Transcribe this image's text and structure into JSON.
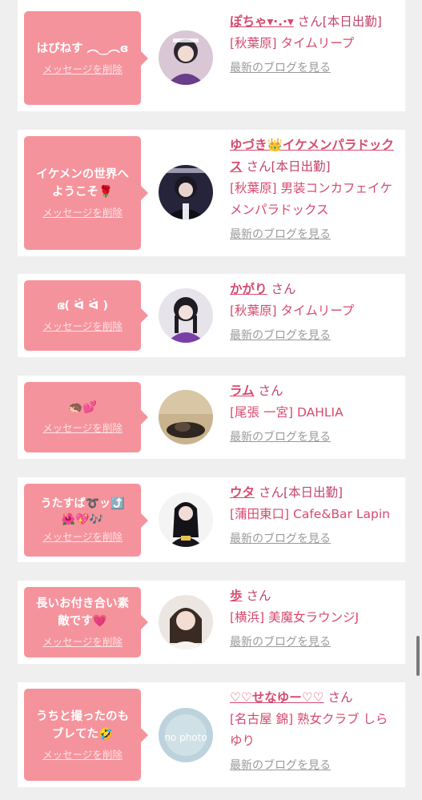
{
  "list": {
    "delete_label": "メッセージを削除",
    "blog_label": "最新のブログを見る",
    "san": "さん",
    "items": [
      {
        "message": "はぴねす ︵‿︵ɞ",
        "name": "ぽちゃ▾·.·▾",
        "after_name": "さん[本日出勤]",
        "shop": "[秋葉原] タイムリープ"
      },
      {
        "message": "イケメンの世界へ\nようこそ🌹",
        "name": "ゆづき👑イケメンパラドックス",
        "after_name": "さん[本日出勤]",
        "shop": "[秋葉原] 男装コンカフェイケメンパラドックス"
      },
      {
        "message": "ഭ( ᐛ ᐛ )",
        "name": "かがり",
        "after_name": "さん",
        "shop": "[秋葉原] タイムリープ"
      },
      {
        "message": "🦔💕",
        "name": "ラム",
        "after_name": "さん",
        "shop": "[尾張 一宮] DAHLIA"
      },
      {
        "message": "うたすぱ➰ッ⤴️\n🌺💖🎶",
        "name": "ウタ",
        "after_name": "さん[本日出勤]",
        "shop": "[蒲田東口] Cafe&Bar Lapin"
      },
      {
        "message": "長いお付き合い素\n敵です💗",
        "name": "歩",
        "after_name": "さん",
        "shop": "[横浜] 美魔女ラウンジJ"
      },
      {
        "message": "うちと撮ったのも\nブレてた🤣",
        "name": "♡♡せなゆー♡♡",
        "after_name": "さん",
        "shop": "[名古屋 錦] 熟女クラブ しらゆり",
        "avatar_text": "no photo"
      }
    ]
  },
  "colors": {
    "bubble": "#f5939c",
    "name": "#d64a6e",
    "link_gray": "#9a9a9a",
    "background": "#efefef"
  }
}
